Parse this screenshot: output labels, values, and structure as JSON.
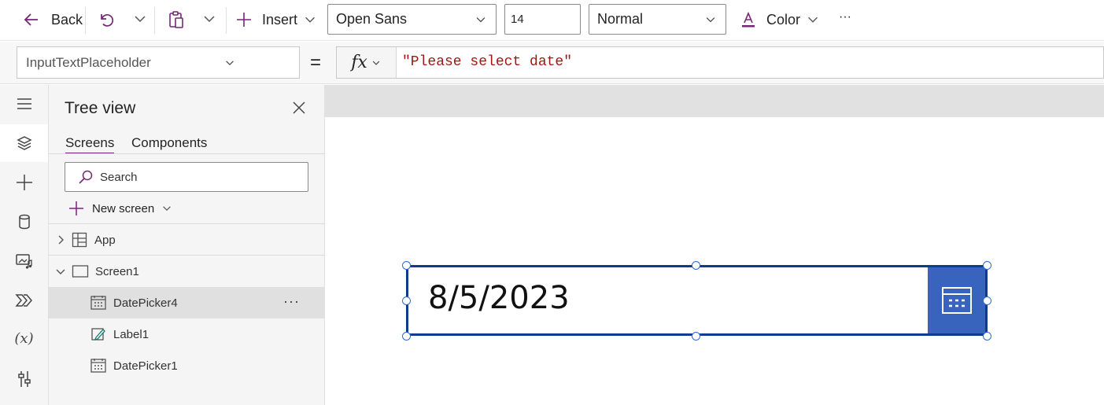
{
  "toolbar": {
    "back_label": "Back",
    "insert_label": "Insert",
    "font_family": "Open Sans",
    "font_size": "14",
    "font_weight": "Normal",
    "color_label": "Color",
    "more_label": "···"
  },
  "formula_bar": {
    "property": "InputTextPlaceholder",
    "equals": "=",
    "fx_label": "fx",
    "formula": "\"Please select date\""
  },
  "rail": {
    "items": [
      "hamburger-menu-icon",
      "layers-icon",
      "plus-icon",
      "database-icon",
      "media-icon",
      "power-automate-icon",
      "variables-icon",
      "tools-icon"
    ],
    "variables_glyph": "(x)"
  },
  "tree_view": {
    "title": "Tree view",
    "tabs": [
      "Screens",
      "Components"
    ],
    "search_placeholder": "Search",
    "new_screen_label": "New screen",
    "nodes": [
      {
        "label": "App",
        "icon": "app-icon"
      },
      {
        "label": "Screen1",
        "icon": "screen-icon"
      },
      {
        "label": "DatePicker4",
        "icon": "calendar-icon",
        "selected": true
      },
      {
        "label": "Label1",
        "icon": "label-edit-icon"
      },
      {
        "label": "DatePicker1",
        "icon": "calendar-icon"
      }
    ],
    "more_label": "···"
  },
  "canvas": {
    "datepicker_value": "8/5/2023",
    "accent_color": "#3864bd",
    "border_color": "#0f3b8c"
  },
  "colors": {
    "brand_purple": "#742774",
    "selection_handle": "#2b6bd6"
  }
}
